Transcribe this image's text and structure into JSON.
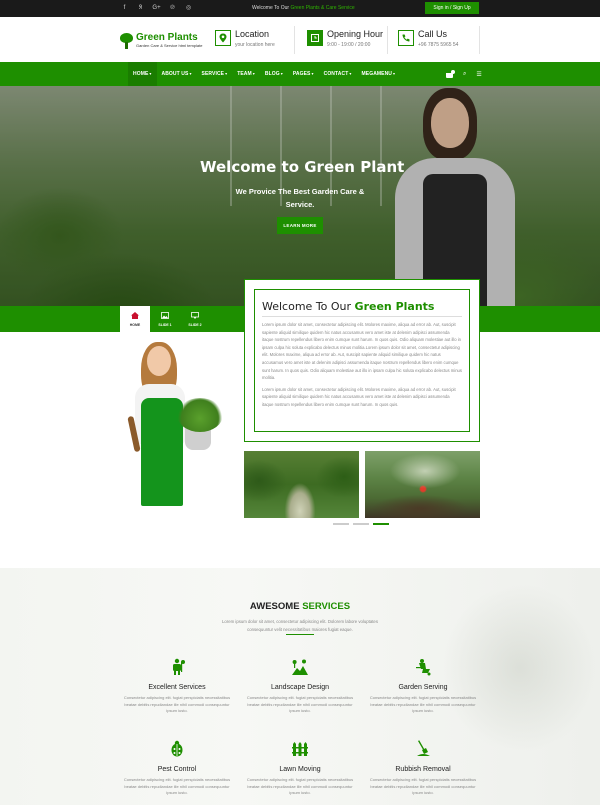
{
  "topbar": {
    "social_icons": [
      "facebook-icon",
      "rss-icon",
      "google-plus-icon",
      "pinterest-icon",
      "instagram-icon"
    ],
    "welcome_prefix": "Welcome To Our",
    "welcome_highlight": "Green Plants & Care Service",
    "signin_label": "Sign in / Sign Up"
  },
  "header": {
    "logo_name": "Green Plants",
    "logo_tagline": "Garden Care & Service html template",
    "location": {
      "title": "Location",
      "sub": "your location here"
    },
    "hours": {
      "title": "Opening Hour",
      "sub": "9:00 - 19:00 / 20:00"
    },
    "call": {
      "title": "Call Us",
      "sub": "+96 7875 5965 54"
    }
  },
  "nav": {
    "items": [
      {
        "label": "HOME",
        "active": true
      },
      {
        "label": "ABOUT US"
      },
      {
        "label": "SERVICE"
      },
      {
        "label": "TEAM"
      },
      {
        "label": "BLOG"
      },
      {
        "label": "PAGES"
      },
      {
        "label": "CONTACT"
      },
      {
        "label": "MEGAMENU"
      }
    ],
    "caret": "▾",
    "cart_icon": "cart-icon",
    "search_icon": "search-icon",
    "menu_icon": "menu-icon"
  },
  "hero": {
    "title": "Welcome to Green Plant",
    "subtitle": "We Provice The Best Garden Care & Service.",
    "button_label": "LEARN MORE"
  },
  "tabs": [
    {
      "label": "HOME",
      "icon": "home-icon",
      "active": true
    },
    {
      "label": "SLIDE 1",
      "icon": "picture-icon"
    },
    {
      "label": "SLIDE 2",
      "icon": "monitor-icon"
    }
  ],
  "welcome_box": {
    "title_prefix": "Welcome To Our",
    "title_highlight": "Green Plants",
    "para1": "Lorem ipsum dolor sit amet, consectetur adipiscing elit. Molores maxime, aliqua ad error ab. Aut, suscipit sapiente aliquid similique quidem hic natus accusamus vero amet iste at delenim adipisci assumenda itaque nostrum repellendus libero enim cumque sunt harum. In quos quis. Odio aliquam molestiae aut illo in ipsam culpa hic soluta explicabo delectus minus molitia.Lorem ipsum dolor sit amet, consectetur adipiscing elit. Molores maxime, aliqua ad error ab. Aut, suscipit sapiente aliquid similique quidem hic natus accusamus vero amet iste at delenim adipisci assumenda itaque nostrum repellendus libero enim cumque sunt harum. In quos quis. Odio aliquam molestiae aut illo in ipsam culpa hic soluta explicabo delectus minus molitia.",
    "para2": "Lorem ipsum dolor sit amet, consectetur adipiscing elit. Molores maxime, aliqua ad error ab. Aut, suscipit sapiente aliquid similique quidem hic natus accusamus vero amet iste at delenim adipisci assumenda itaque nostrum repellendus libero enim cumque sunt harum. In quos quis."
  },
  "slider_dots": 3,
  "services": {
    "title_prefix": "AWESOME",
    "title_highlight": "SERVICES",
    "intro": "Lorem ipsum dolor sit amet, consectetur adipiscing elit. Dolorem labore voluptates consequuntur velit necessitatibus maiores fugiat eaque.",
    "items": [
      {
        "name": "Excellent Services",
        "icon": "gardener-icon",
        "desc": "Consectetur adipiscing elit. fugiat perspiciatis necessitatibus beatae debitis repudiandae ille nihil commodi consequuntur ipsum iusto."
      },
      {
        "name": "Landscape Design",
        "icon": "landscape-icon",
        "desc": "Consectetur adipiscing elit. fugiat perspiciatis necessitatibus beatae debitis repudiandae ille nihil commodi consequuntur ipsum iusto."
      },
      {
        "name": "Garden Serving",
        "icon": "wheelbarrow-icon",
        "desc": "Consectetur adipiscing elit. fugiat perspiciatis necessitatibus beatae debitis repudiandae ille nihil commodi consequuntur ipsum iusto."
      },
      {
        "name": "Pest Control",
        "icon": "bug-icon",
        "desc": "Consectetur adipiscing elit. fugiat perspiciatis necessitatibus beatae debitis repudiandae ille nihil commodi consequuntur ipsum iusto."
      },
      {
        "name": "Lawn Moving",
        "icon": "fence-icon",
        "desc": "Consectetur adipiscing elit. fugiat perspiciatis necessitatibus beatae debitis repudiandae ille nihil commodi consequuntur ipsum iusto."
      },
      {
        "name": "Rubbish Removal",
        "icon": "shovel-icon",
        "desc": "Consectetur adipiscing elit. fugiat perspiciatis necessitatibus beatae debitis repudiandae ille nihil commodi consequuntur ipsum iusto."
      }
    ]
  },
  "colors": {
    "brand_green": "#1e8f00",
    "dark_bar": "#1a1a1a"
  }
}
